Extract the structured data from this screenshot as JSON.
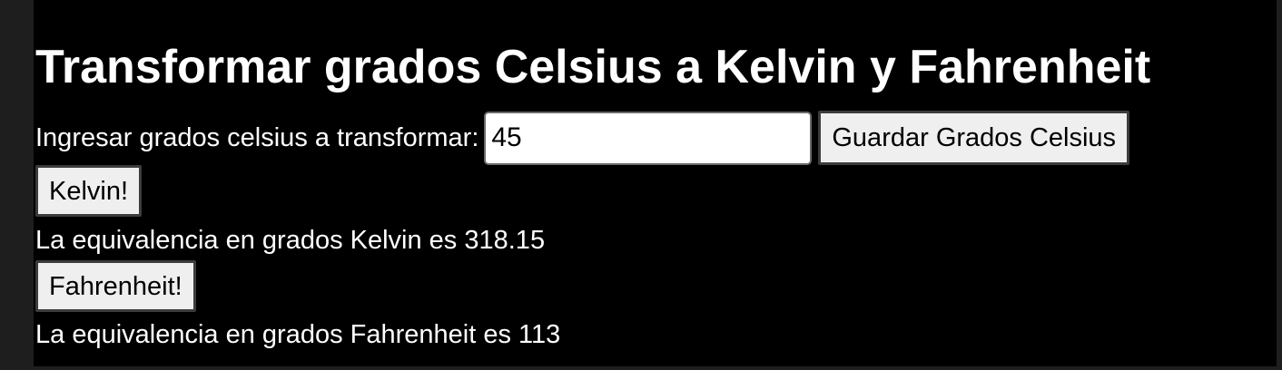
{
  "page": {
    "heading": "Transformar grados Celsius a Kelvin y Fahrenheit"
  },
  "form": {
    "label": "Ingresar grados celsius a transformar:",
    "input_value": "45",
    "save_button_label": "Guardar Grados Celsius"
  },
  "kelvin": {
    "button_label": "Kelvin!",
    "result_text": "La equivalencia en grados Kelvin es 318.15"
  },
  "fahrenheit": {
    "button_label": "Fahrenheit!",
    "result_text": "La equivalencia en grados Fahrenheit es 113"
  },
  "colors": {
    "background": "#000000",
    "text": "#ffffff",
    "button_background": "#efefef",
    "gutter": "#1e1e1e"
  }
}
